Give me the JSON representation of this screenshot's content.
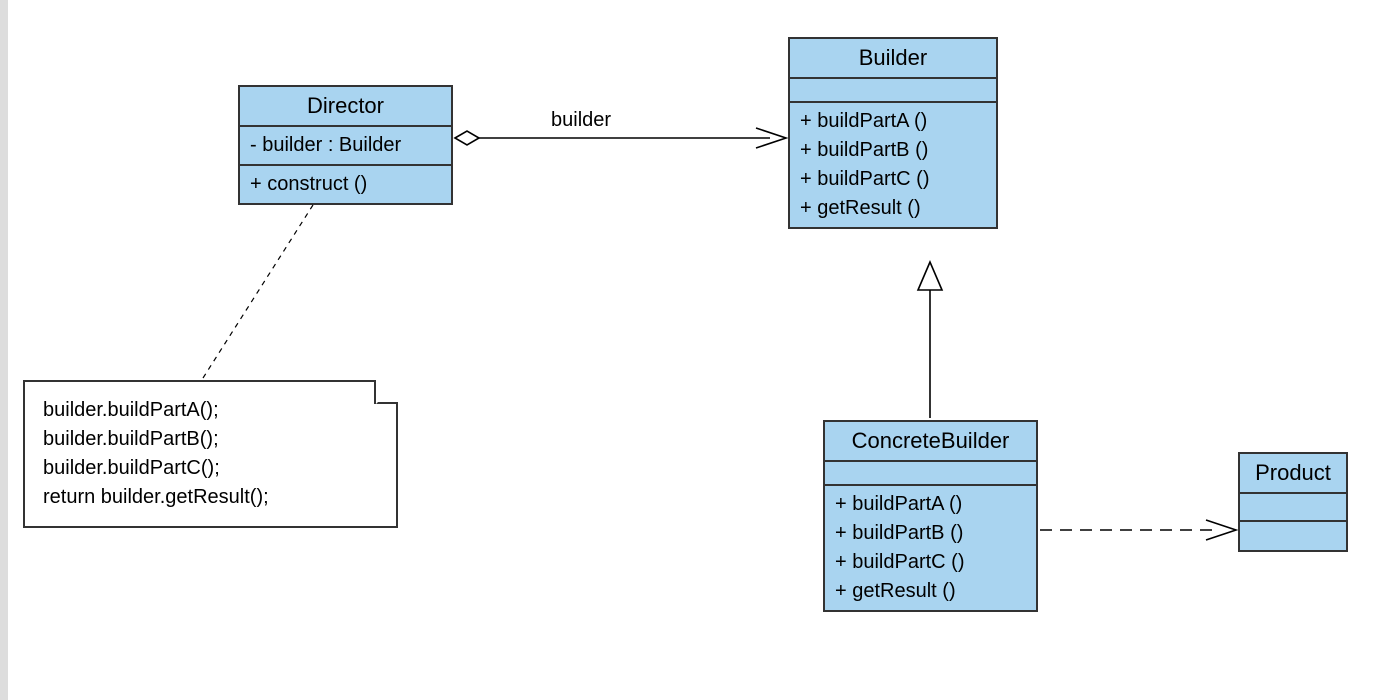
{
  "classes": {
    "director": {
      "name": "Director",
      "attrs": [
        "- builder  : Builder"
      ],
      "ops": [
        "+  construct ()"
      ]
    },
    "builder": {
      "name": "Builder",
      "attrs": [],
      "ops": [
        "+  buildPartA ()",
        "+  buildPartB ()",
        "+  buildPartC ()",
        "+  getResult ()"
      ]
    },
    "concreteBuilder": {
      "name": "ConcreteBuilder",
      "attrs": [],
      "ops": [
        "+  buildPartA ()",
        "+  buildPartB ()",
        "+  buildPartC ()",
        "+  getResult ()"
      ]
    },
    "product": {
      "name": "Product",
      "attrs": [],
      "ops": []
    }
  },
  "note": {
    "lines": [
      "builder.buildPartA();",
      "builder.buildPartB();",
      "builder.buildPartC();",
      "return builder.getResult();"
    ]
  },
  "edges": {
    "directorToBuilder": {
      "label": "builder"
    }
  }
}
